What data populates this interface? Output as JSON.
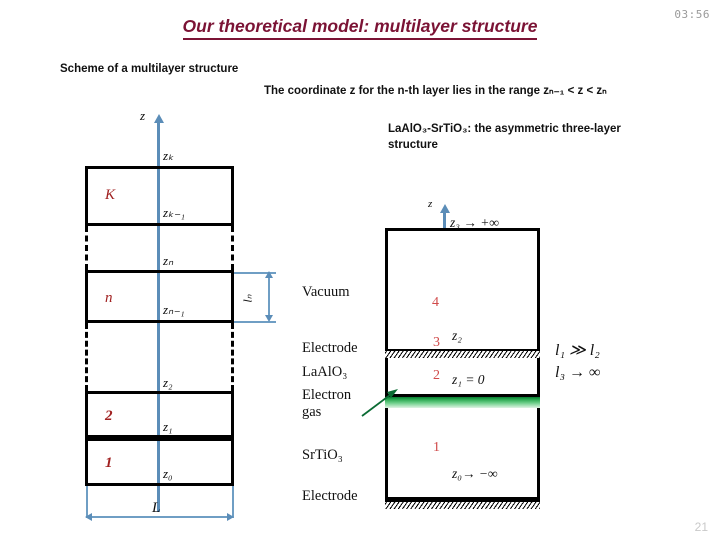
{
  "slide": {
    "title": "Our theoretical model: multilayer structure",
    "clock": "03:56",
    "number": "21",
    "title_color": "#7b1335"
  },
  "captions": {
    "scheme": "Scheme of a multilayer structure",
    "coordinate_range": "The coordinate z for the n-th layer lies in the range zₙ₋₁ < z < zₙ",
    "lao_sto": "LaAlO₃-SrTiO₃: the asymmetric three-layer structure"
  },
  "left_diagram": {
    "name": "multilayer-scheme",
    "axis_label": "z",
    "total_width_label": "L",
    "thickness_label": "lₙ",
    "layers": [
      {
        "id": "K",
        "number": "K",
        "top_boundary": "zₖ",
        "bottom_boundary": "zₖ₋₁",
        "style": "solid"
      },
      {
        "id": "gap-upper",
        "number": "",
        "top_boundary": "",
        "bottom_boundary": "",
        "style": "dashed"
      },
      {
        "id": "n",
        "number": "n",
        "top_boundary": "zₙ",
        "bottom_boundary": "zₙ₋₁",
        "style": "solid"
      },
      {
        "id": "gap-lower",
        "number": "",
        "top_boundary": "",
        "bottom_boundary": "",
        "style": "dashed"
      },
      {
        "id": "2",
        "number": "2",
        "top_boundary": "z₂",
        "bottom_boundary": "z₁",
        "style": "solid"
      },
      {
        "id": "1",
        "number": "1",
        "top_boundary": "z₁",
        "bottom_boundary": "z₀",
        "style": "solid"
      }
    ],
    "boundary_labels": {
      "zK": "zₖ",
      "zK1": "zₖ₋₁",
      "zn": "zₙ",
      "zn1": "zₙ₋₁",
      "z2": "z₂",
      "z1": "z₁",
      "z0": "z₀"
    }
  },
  "right_diagram": {
    "name": "lao-sto-three-layer",
    "axis_label": "z",
    "material_labels": [
      "Vacuum",
      "Electrode",
      "LaAlO₃",
      "Electron gas",
      "SrTiO₃",
      "Electrode"
    ],
    "region_numbers": [
      "4",
      "3",
      "2",
      "1"
    ],
    "boundary_labels": {
      "z3": "z₃ → +∞",
      "z2": "z₂",
      "z1": "z₁ = 0",
      "z0": "z₀→ −∞"
    },
    "conditions": [
      "l₁ ≫ l₂",
      "l₃ → ∞"
    ],
    "electron_gas_color": "#22a24a",
    "number_color": "#d04a4a"
  }
}
